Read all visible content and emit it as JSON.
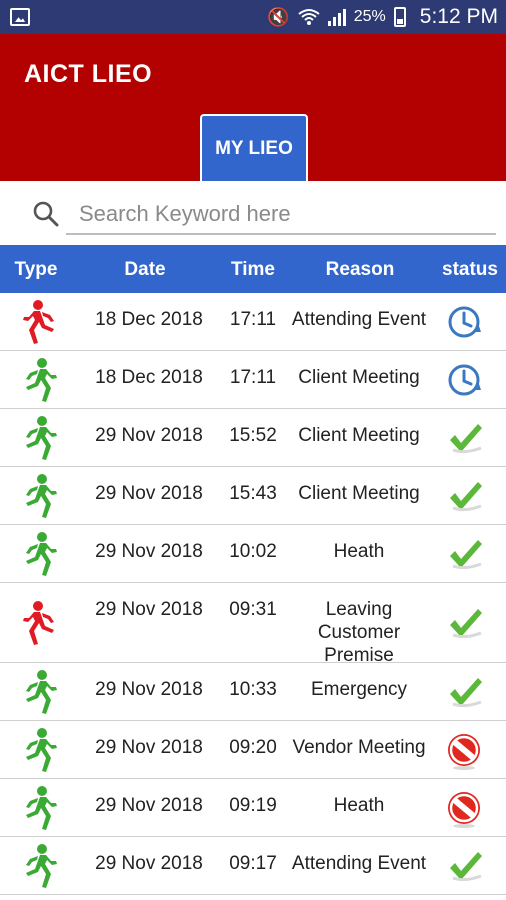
{
  "status_bar": {
    "battery_percent": "25%",
    "time": "5:12 PM",
    "icons": [
      "image-icon",
      "mute-icon",
      "wifi-icon",
      "signal-icon",
      "battery-charging-icon"
    ]
  },
  "header": {
    "title": "AICT LIEO",
    "tab_label": "MY LIEO",
    "background_color": "#b30000",
    "accent_color": "#3366cc"
  },
  "search": {
    "placeholder": "Search Keyword here",
    "value": ""
  },
  "table": {
    "columns": [
      "Type",
      "Date",
      "Time",
      "Reason",
      "status"
    ],
    "rows": [
      {
        "type": "exit-red",
        "date": "18 Dec 2018",
        "time": "17:11",
        "reason": "Attending Event",
        "status": "pending"
      },
      {
        "type": "enter-green",
        "date": "18 Dec 2018",
        "time": "17:11",
        "reason": "Client Meeting",
        "status": "pending"
      },
      {
        "type": "enter-green",
        "date": "29 Nov 2018",
        "time": "15:52",
        "reason": "Client Meeting",
        "status": "approved"
      },
      {
        "type": "enter-green",
        "date": "29 Nov 2018",
        "time": "15:43",
        "reason": "Client Meeting",
        "status": "approved"
      },
      {
        "type": "enter-green",
        "date": "29 Nov 2018",
        "time": "10:02",
        "reason": "Heath",
        "status": "approved"
      },
      {
        "type": "exit-red",
        "date": "29 Nov 2018",
        "time": "09:31",
        "reason": "Leaving Customer Premise",
        "status": "approved"
      },
      {
        "type": "enter-green",
        "date": "29 Nov 2018",
        "time": "10:33",
        "reason": "Emergency",
        "status": "approved"
      },
      {
        "type": "enter-green",
        "date": "29 Nov 2018",
        "time": "09:20",
        "reason": "Vendor Meeting",
        "status": "rejected"
      },
      {
        "type": "enter-green",
        "date": "29 Nov 2018",
        "time": "09:19",
        "reason": "Heath",
        "status": "rejected"
      },
      {
        "type": "enter-green",
        "date": "29 Nov 2018",
        "time": "09:17",
        "reason": "Attending Event",
        "status": "approved"
      }
    ]
  }
}
